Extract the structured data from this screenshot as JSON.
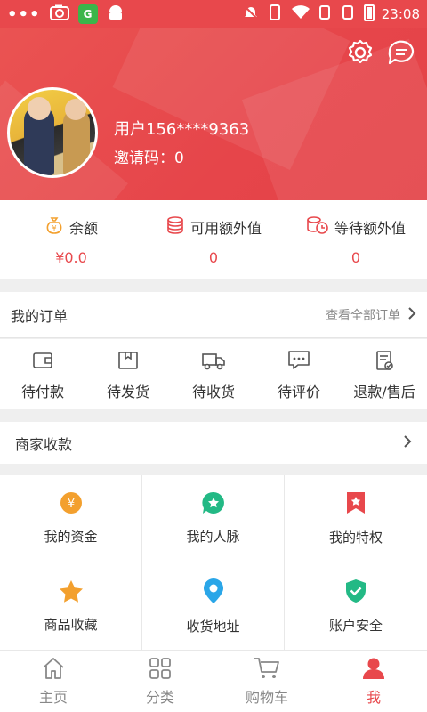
{
  "status_bar": {
    "dots": "•••",
    "time": "23:08"
  },
  "header": {
    "username": "用户156****9363",
    "invite_code": "邀请码：0"
  },
  "balances": [
    {
      "label": "余额",
      "value": "¥0.0",
      "icon": "money-bag-icon"
    },
    {
      "label": "可用额外值",
      "value": "0",
      "icon": "coins-stack-icon"
    },
    {
      "label": "等待额外值",
      "value": "0",
      "icon": "coins-clock-icon"
    }
  ],
  "orders": {
    "title": "我的订单",
    "view_all": "查看全部订单",
    "items": [
      {
        "label": "待付款",
        "icon": "wallet-icon"
      },
      {
        "label": "待发货",
        "icon": "box-icon"
      },
      {
        "label": "待收货",
        "icon": "truck-icon"
      },
      {
        "label": "待评价",
        "icon": "comment-icon"
      },
      {
        "label": "退款/售后",
        "icon": "refund-icon"
      }
    ]
  },
  "merchant": {
    "label": "商家收款"
  },
  "grid": [
    {
      "label": "我的资金",
      "icon": "yuan-coin-icon",
      "color": "#f3a02e"
    },
    {
      "label": "我的人脉",
      "icon": "star-badge-icon",
      "color": "#23b985"
    },
    {
      "label": "我的特权",
      "icon": "privilege-flag-icon",
      "color": "#e8484c"
    },
    {
      "label": "商品收藏",
      "icon": "star-icon",
      "color": "#f3a02e"
    },
    {
      "label": "收货地址",
      "icon": "location-pin-icon",
      "color": "#2aa6e8"
    },
    {
      "label": "账户安全",
      "icon": "shield-check-icon",
      "color": "#23b985"
    }
  ],
  "tabbar": [
    {
      "label": "主页",
      "icon": "home-icon"
    },
    {
      "label": "分类",
      "icon": "grid-icon"
    },
    {
      "label": "购物车",
      "icon": "cart-icon"
    },
    {
      "label": "我",
      "icon": "user-icon",
      "active": true
    }
  ],
  "colors": {
    "accent": "#e8484c",
    "orange": "#f3a02e",
    "green": "#23b985",
    "blue": "#2aa6e8"
  }
}
